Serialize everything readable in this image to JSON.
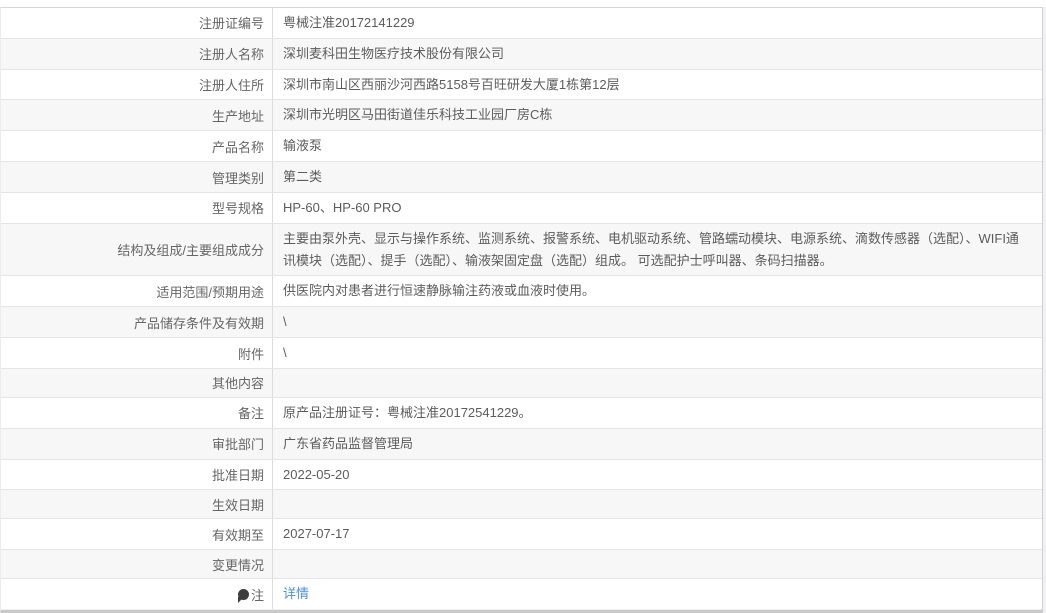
{
  "page": {
    "background": "#f1f1f4"
  },
  "colors": {
    "link": "#4a90d9",
    "alt_row": "#f7f7f7",
    "border": "#e5e5e5"
  },
  "table": {
    "rows": [
      {
        "label": "注册证编号",
        "value": "粤械注准20172141229"
      },
      {
        "label": "注册人名称",
        "value": "深圳麦科田生物医疗技术股份有限公司"
      },
      {
        "label": "注册人住所",
        "value": "深圳市南山区西丽沙河西路5158号百旺研发大厦1栋第12层"
      },
      {
        "label": "生产地址",
        "value": "深圳市光明区马田街道佳乐科技工业园厂房C栋"
      },
      {
        "label": "产品名称",
        "value": "输液泵"
      },
      {
        "label": "管理类别",
        "value": "第二类"
      },
      {
        "label": "型号规格",
        "value": "HP-60、HP-60 PRO"
      },
      {
        "label": "结构及组成/主要组成成分",
        "value": "主要由泵外壳、显示与操作系统、监测系统、报警系统、电机驱动系统、管路蠕动模块、电源系统、滴数传感器（选配）、WIFI通讯模块（选配）、提手（选配）、输液架固定盘（选配）组成。 可选配护士呼叫器、条码扫描器。"
      },
      {
        "label": "适用范围/预期用途",
        "value": "供医院内对患者进行恒速静脉输注药液或血液时使用。"
      },
      {
        "label": "产品储存条件及有效期",
        "value": "\\"
      },
      {
        "label": "附件",
        "value": "\\"
      },
      {
        "label": "其他内容",
        "value": ""
      },
      {
        "label": "备注",
        "value": "原产品注册证号：粤械注准20172541229。"
      },
      {
        "label": "审批部门",
        "value": "广东省药品监督管理局"
      },
      {
        "label": "批准日期",
        "value": "2022-05-20"
      },
      {
        "label": "生效日期",
        "value": ""
      },
      {
        "label": "有效期至",
        "value": "2027-07-17"
      },
      {
        "label": "变更情况",
        "value": ""
      }
    ],
    "note_row": {
      "label": "注",
      "link_text": "详情"
    }
  }
}
